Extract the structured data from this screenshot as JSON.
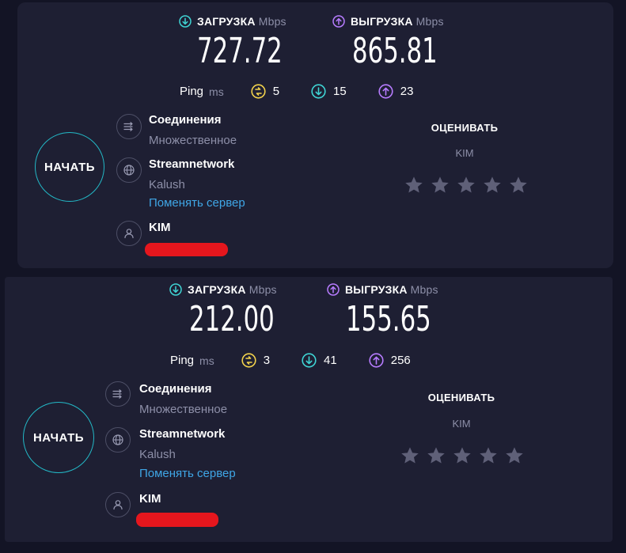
{
  "panels": [
    {
      "download": {
        "label": "ЗАГРУЗКА",
        "unit": "Mbps",
        "value": "727.72"
      },
      "upload": {
        "label": "ВЫГРУЗКА",
        "unit": "Mbps",
        "value": "865.81"
      },
      "ping": {
        "label": "Ping",
        "unit": "ms",
        "idle": "5",
        "down": "15",
        "up": "23"
      },
      "start_label": "НАЧАТЬ",
      "connections": {
        "title": "Соединения",
        "value": "Множественное"
      },
      "server": {
        "title": "Streamnetwork",
        "location": "Kalush",
        "change_link": "Поменять сервер"
      },
      "provider": {
        "title": "KIM"
      },
      "rating": {
        "title": "ОЦЕНИВАТЬ",
        "provider": "KIM",
        "stars": 5
      }
    },
    {
      "download": {
        "label": "ЗАГРУЗКА",
        "unit": "Mbps",
        "value": "212.00"
      },
      "upload": {
        "label": "ВЫГРУЗКА",
        "unit": "Mbps",
        "value": "155.65"
      },
      "ping": {
        "label": "Ping",
        "unit": "ms",
        "idle": "3",
        "down": "41",
        "up": "256"
      },
      "start_label": "НАЧАТЬ",
      "connections": {
        "title": "Соединения",
        "value": "Множественное"
      },
      "server": {
        "title": "Streamnetwork",
        "location": "Kalush",
        "change_link": "Поменять сервер"
      },
      "provider": {
        "title": "KIM"
      },
      "rating": {
        "title": "ОЦЕНИВАТЬ",
        "provider": "KIM",
        "stars": 5
      }
    }
  ],
  "colors": {
    "background": "#131425",
    "panel": "#1e1f33",
    "download_accent": "#3fd4d4",
    "upload_accent": "#b77cff",
    "ping_idle": "#f2d24c",
    "link": "#3fa6e6",
    "start_ring": "#23b8c6",
    "star": "#5f6078",
    "redaction": "#e5161d"
  },
  "icons": {
    "download": "arrow-down-circle-icon",
    "upload": "arrow-up-circle-icon",
    "idle_ping": "idle-latency-icon",
    "connections": "connections-icon",
    "server": "globe-icon",
    "provider": "user-icon",
    "star": "star-icon"
  }
}
